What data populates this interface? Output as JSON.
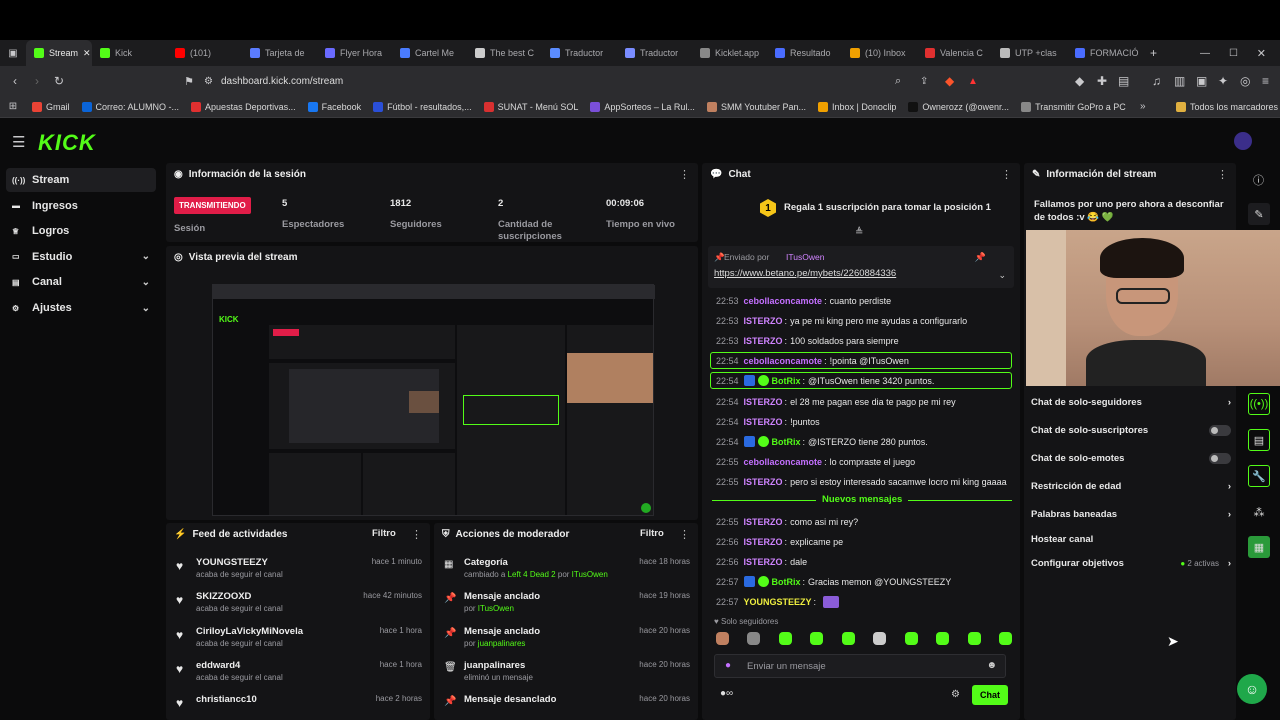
{
  "browser": {
    "tabs": [
      {
        "label": "Stream",
        "color": "#53fc18",
        "active": true
      },
      {
        "label": "Kick",
        "color": "#53fc18"
      },
      {
        "label": "(101)",
        "color": "#ff0000"
      },
      {
        "label": "Tarjeta de",
        "color": "#5b7cff"
      },
      {
        "label": "Flyer Hora",
        "color": "#6a6aff"
      },
      {
        "label": "Cartel Me",
        "color": "#4a7cff"
      },
      {
        "label": "The best C",
        "color": "#cccccc"
      },
      {
        "label": "Traductor",
        "color": "#5b8cff"
      },
      {
        "label": "Traductor",
        "color": "#7a8cff"
      },
      {
        "label": "Kicklet.app",
        "color": "#888888"
      },
      {
        "label": "Resultado",
        "color": "#4a6cff"
      },
      {
        "label": "(10) Inbox",
        "color": "#f0a000"
      },
      {
        "label": "Valencia C",
        "color": "#e03030"
      },
      {
        "label": "UTP +clas",
        "color": "#bbbbbb"
      },
      {
        "label": "FORMACIÓ",
        "color": "#4a6cff"
      }
    ],
    "url": "dashboard.kick.com/stream",
    "bookmarks": [
      {
        "label": "Gmail",
        "color": "#ea4335"
      },
      {
        "label": "Correo: ALUMNO -...",
        "color": "#0a64d8"
      },
      {
        "label": "Apuestas Deportivas...",
        "color": "#e03030"
      },
      {
        "label": "Facebook",
        "color": "#1877f2"
      },
      {
        "label": "Fútbol - resultados,...",
        "color": "#2a4fd8"
      },
      {
        "label": "SUNAT - Menú SOL",
        "color": "#d83030"
      },
      {
        "label": "AppSorteos – La Rul...",
        "color": "#7a4fd8"
      },
      {
        "label": "SMM Youtuber Pan...",
        "color": "#c08060"
      },
      {
        "label": "Inbox | Donoclip",
        "color": "#f0a000"
      },
      {
        "label": "Ownerozz (@owenr...",
        "color": "#111111"
      },
      {
        "label": "Transmitir GoPro a PC",
        "color": "#888888"
      }
    ],
    "all_bookmarks": "Todos los marcadores"
  },
  "logo": "KICK",
  "sidebar": {
    "items": [
      {
        "label": "Stream",
        "icon": "broadcast-icon"
      },
      {
        "label": "Ingresos",
        "icon": "wallet-icon"
      },
      {
        "label": "Logros",
        "icon": "trophy-icon"
      },
      {
        "label": "Estudio",
        "icon": "studio-icon"
      },
      {
        "label": "Canal",
        "icon": "channel-icon"
      },
      {
        "label": "Ajustes",
        "icon": "gear-icon"
      }
    ]
  },
  "session": {
    "title": "Información de la sesión",
    "status": "TRANSMITIENDO",
    "status_label": "Sesión",
    "stats": [
      {
        "value": "5",
        "label": "Espectadores"
      },
      {
        "value": "1812",
        "label": "Seguidores"
      },
      {
        "value": "2",
        "label": "Cantidad de suscripciones"
      },
      {
        "value": "00:09:06",
        "label": "Tiempo en vivo"
      }
    ]
  },
  "preview": {
    "title": "Vista previa del stream"
  },
  "feed": {
    "title": "Feed de actividades",
    "filter": "Filtro",
    "items": [
      {
        "name": "YOUNGSTEEZY",
        "sub": "acaba de seguir el canal",
        "time": "hace 1 minuto"
      },
      {
        "name": "SKIZZOOXD",
        "sub": "acaba de seguir el canal",
        "time": "hace 42 minutos"
      },
      {
        "name": "CiriloyLaVickyMiNovela",
        "sub": "acaba de seguir el canal",
        "time": "hace 1 hora"
      },
      {
        "name": "eddward4",
        "sub": "acaba de seguir el canal",
        "time": "hace 1 hora"
      },
      {
        "name": "christiancc10",
        "sub": "",
        "time": "hace 2 horas"
      }
    ]
  },
  "mod": {
    "title": "Acciones de moderador",
    "filter": "Filtro",
    "items": [
      {
        "title": "Categoría",
        "pre": "cambiado a ",
        "hl": "Left 4 Dead 2",
        "mid": " por ",
        "user": "ITusOwen",
        "time": "hace 18 horas"
      },
      {
        "title": "Mensaje anclado",
        "pre": "por ",
        "hl": "",
        "mid": "",
        "user": "ITusOwen",
        "time": "hace 19 horas"
      },
      {
        "title": "Mensaje anclado",
        "pre": "por ",
        "hl": "",
        "mid": "",
        "user": "juanpalinares",
        "time": "hace 20 horas"
      },
      {
        "title": "juanpalinares",
        "pre": "eliminó un mensaje",
        "hl": "",
        "mid": "",
        "user": "",
        "time": "hace 20 horas"
      },
      {
        "title": "Mensaje desanclado",
        "pre": "",
        "hl": "",
        "mid": "",
        "user": "",
        "time": "hace 20 horas"
      }
    ]
  },
  "chat": {
    "title": "Chat",
    "gift_text": "Regala 1 suscripción para tomar la posición 1",
    "gift_number": "1",
    "pinned_by": "Enviado por",
    "pinned_user": "ITusOwen",
    "pinned_link": "https://www.betano.pe/mybets/2260884336",
    "new_messages": "Nuevos mensajes",
    "messages": [
      {
        "time": "22:53",
        "user": "cebollaconcamote",
        "color": "#c470ff",
        "text": "cuanto perdiste"
      },
      {
        "time": "22:53",
        "user": "ISTERZO",
        "color": "#d084ff",
        "text": "ya pe mi king pero me ayudas a configurarlo"
      },
      {
        "time": "22:53",
        "user": "ISTERZO",
        "color": "#d084ff",
        "text": "100 soldados para siempre"
      },
      {
        "time": "22:54",
        "user": "cebollaconcamote",
        "color": "#c470ff",
        "text": "!pointa @ITusOwen",
        "hl": true
      },
      {
        "time": "22:54",
        "user": "BotRix",
        "color": "#53fc18",
        "text": "@ITusOwen tiene 3420 puntos.",
        "hl": true,
        "bot": true
      },
      {
        "time": "22:54",
        "user": "ISTERZO",
        "color": "#d084ff",
        "text": "el 28 me pagan ese dia te pago pe mi rey"
      },
      {
        "time": "22:54",
        "user": "ISTERZO",
        "color": "#d084ff",
        "text": "!puntos"
      },
      {
        "time": "22:54",
        "user": "BotRix",
        "color": "#53fc18",
        "text": "@ISTERZO tiene 280 puntos.",
        "bot": true
      },
      {
        "time": "22:55",
        "user": "cebollaconcamote",
        "color": "#c470ff",
        "text": "lo compraste el juego"
      },
      {
        "time": "22:55",
        "user": "ISTERZO",
        "color": "#d084ff",
        "text": "pero si estoy interesado sacamwe locro mi king gaaaa"
      },
      {
        "time": "22:55",
        "user": "ISTERZO",
        "color": "#d084ff",
        "text": "como asi mi rey?"
      },
      {
        "time": "22:56",
        "user": "ISTERZO",
        "color": "#d084ff",
        "text": "explicame pe"
      },
      {
        "time": "22:56",
        "user": "ISTERZO",
        "color": "#d084ff",
        "text": "dale"
      },
      {
        "time": "22:57",
        "user": "BotRix",
        "color": "#53fc18",
        "text": "Gracias memon @YOUNGSTEEZY",
        "bot": true
      },
      {
        "time": "22:57",
        "user": "YOUNGSTEEZY",
        "color": "#f0f040",
        "text": ""
      }
    ],
    "followers_only": "Solo seguidores",
    "input_placeholder": "Enviar un mensaje",
    "send": "Chat"
  },
  "stream_info": {
    "title": "Información del stream",
    "stream_title": "Fallamos por uno pero ahora a desconfiar de todos :v 😂 💚",
    "settings": [
      {
        "label": "Chat de solo-seguidores",
        "control": "chevron"
      },
      {
        "label": "Chat de solo-suscriptores",
        "control": "toggle"
      },
      {
        "label": "Chat de solo-emotes",
        "control": "toggle"
      },
      {
        "label": "Restricción de edad",
        "control": "chevron"
      },
      {
        "label": "Palabras baneadas",
        "control": "chevron"
      },
      {
        "label": "Hostear canal",
        "control": "none"
      },
      {
        "label": "Configurar objetivos",
        "control": "chevron",
        "extra": "2 activas"
      }
    ]
  },
  "colors": {
    "accent": "#53fc18",
    "bg": "#0b0b0c",
    "panel": "#141416",
    "live": "#e11d48"
  }
}
